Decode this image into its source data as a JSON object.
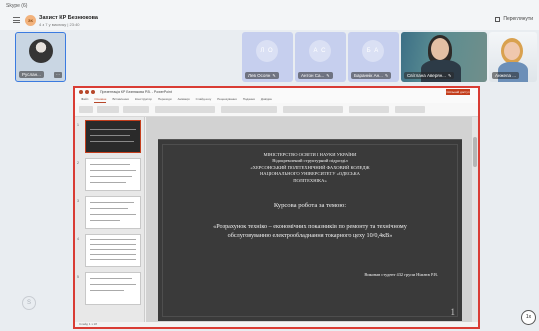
{
  "window": {
    "title": "Skype (6)"
  },
  "call": {
    "group_initials": "ЗК",
    "title": "Захист КР Безнюкова",
    "subtitle": "4 з 7 у виклику | 23:40",
    "layout_label": "Переглянути"
  },
  "participants": [
    {
      "name": "Руслан...",
      "initials": "",
      "kind": "self"
    },
    {
      "name": "Лев Осоян",
      "initials": "Л О",
      "kind": "initials"
    },
    {
      "name": "Антон Са...",
      "initials": "А С",
      "kind": "initials"
    },
    {
      "name": "Бараннік Ан...",
      "initials": "Б А",
      "kind": "initials"
    },
    {
      "name": "Світлана Аверян...",
      "initials": "",
      "kind": "photo"
    },
    {
      "name": "Анжела ...",
      "initials": "",
      "kind": "photo"
    }
  ],
  "powerpoint": {
    "title_text": "Презентація КР Безнюкова Р.В. - PowerPoint",
    "share_button": "Спільний доступ",
    "tabs": [
      "Файл",
      "Основне",
      "Вставлення",
      "Конструктор",
      "Переходи",
      "Анімація",
      "Слайд-шоу",
      "Рецензування",
      "Подання",
      "Довідка"
    ],
    "active_tab": "Основне",
    "thumb_numbers": [
      "1",
      "2",
      "3",
      "4",
      "5"
    ],
    "status_text": "Слайд 1 з 18"
  },
  "slide": {
    "header_lines": [
      "МІНІСТЕРСТВО ОСВІТИ І НАУКИ УКРАЇНИ",
      "Відокремлений структурний підрозділ",
      "«ХЕРСОНСЬКИЙ ПОЛІТЕХНІЧНИЙ ФАХОВИЙ КОЛЕДЖ",
      "НАЦІОНАЛЬНОГО УНІВЕРСИТЕТУ «ОДЕСЬКА",
      "ПОЛІТЕХНІКА»"
    ],
    "topic_label": "Курсова робота за темою:",
    "main_line1": "«Розрахунок техніко – економічних показників по ремонту та технічному",
    "main_line2": "обслуговуванню електрообладнання  токарного цеху 10/0,4кВ»",
    "author": "Виконав студент 432 групи Ніжнєв Р.В.",
    "page_number": "1"
  },
  "controls": {
    "side_button": "S",
    "zoom_button": "1x"
  },
  "colors": {
    "share_border": "#d93c34",
    "accent": "#3b7be0",
    "ppt_brand": "#c43e1c"
  }
}
